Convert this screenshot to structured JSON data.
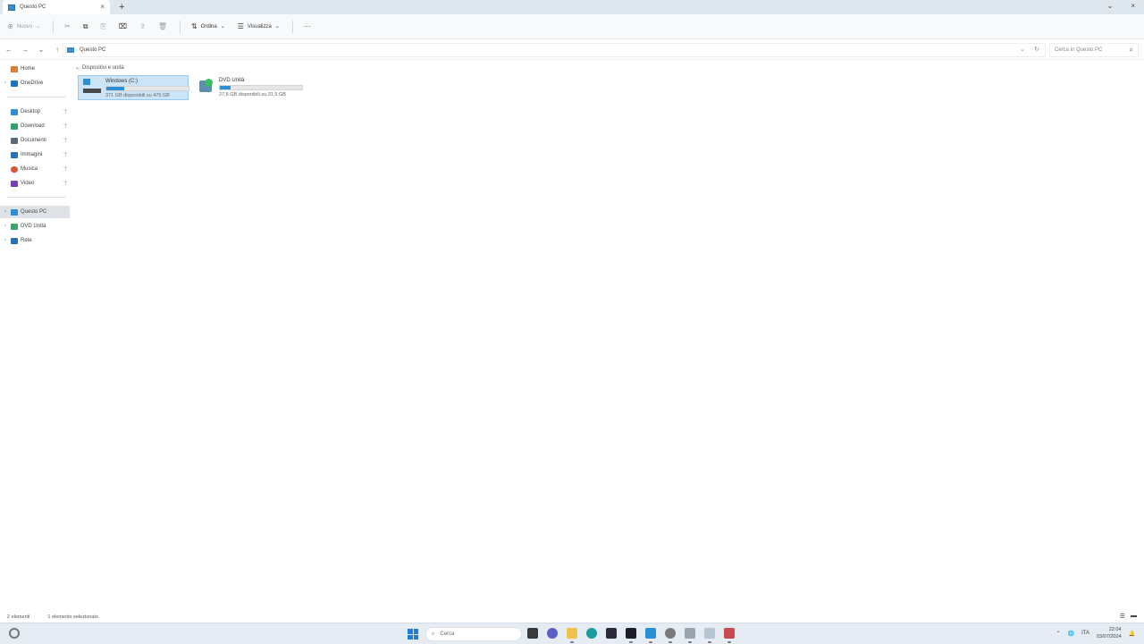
{
  "window": {
    "tab_title": "Questo PC",
    "new_tab_symbol": "+",
    "minimize_symbol": "⌄",
    "close_symbol": "×"
  },
  "commands": {
    "new_label": "Nuovo",
    "sort_label": "Ordina",
    "view_label": "Visualizza",
    "more_symbol": "···"
  },
  "address": {
    "breadcrumb": "Questo PC",
    "search_placeholder": "Cerca in Questo PC"
  },
  "sidebar": {
    "items": [
      {
        "label": "Home",
        "icon": "home-icon",
        "color": "#e07b39"
      },
      {
        "label": "OneDrive",
        "icon": "cloud-icon",
        "color": "#1f74c7"
      },
      {
        "label": "Desktop",
        "icon": "desktop-icon",
        "color": "#2b8fd6"
      },
      {
        "label": "Download",
        "icon": "download-icon",
        "color": "#2ba36b"
      },
      {
        "label": "Documenti",
        "icon": "document-icon",
        "color": "#5a6a7a"
      },
      {
        "label": "Immagini",
        "icon": "image-icon",
        "color": "#2b6fb5"
      },
      {
        "label": "Musica",
        "icon": "music-icon",
        "color": "#d9553a"
      },
      {
        "label": "Video",
        "icon": "video-icon",
        "color": "#7b3fb5"
      },
      {
        "label": "Questo PC",
        "icon": "pc-icon",
        "color": "#2b8fd6"
      },
      {
        "label": "DVD Unità",
        "icon": "dvd-icon",
        "color": "#3aa46a"
      },
      {
        "label": "Rete",
        "icon": "network-icon",
        "color": "#2b6fb5"
      }
    ],
    "pin_symbol": "📌"
  },
  "main": {
    "group_label": "Dispositivi e unità",
    "drives": [
      {
        "name": "Windows (C:)",
        "free_text": "371 GB disponibili su 475 GB",
        "used_fraction": 0.22,
        "icon": "windows-drive-icon"
      },
      {
        "name": "DVD Unità",
        "free_text": "27,5 GB disponibili su 31,5 GB",
        "used_fraction": 0.13,
        "icon": "dvd-drive-icon"
      }
    ]
  },
  "status": {
    "items_count": "2 elementi",
    "selected": "1 elemento selezionato"
  },
  "taskbar": {
    "search_placeholder": "Cerca",
    "language": "ITA",
    "time": "22:04",
    "date": "03/07/2024"
  }
}
